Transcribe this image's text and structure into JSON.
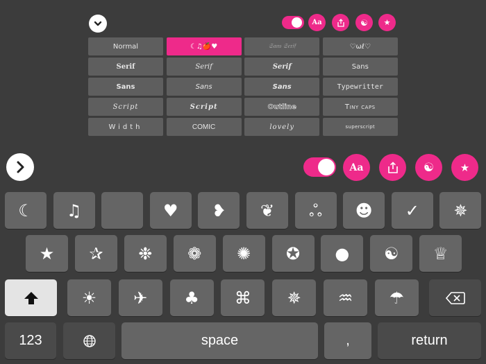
{
  "colors": {
    "accent": "#ee2a8a",
    "background": "#3c3c3c",
    "key": "#656565",
    "key_dark": "#4a4a4a",
    "shift_key": "#e4e4e4"
  },
  "mini_toolbar": {
    "collapse_icon": "chevron-down-icon",
    "toggle_on": true,
    "buttons": [
      {
        "name": "font-style-button",
        "icon": "font-aa-icon",
        "label": "Aa"
      },
      {
        "name": "share-button",
        "icon": "share-icon",
        "label": ""
      },
      {
        "name": "theme-button",
        "icon": "yin-yang-icon",
        "label": "☯"
      },
      {
        "name": "favorites-button",
        "icon": "star-icon",
        "label": "★"
      }
    ]
  },
  "styles": [
    {
      "label": "Normal",
      "cls": "",
      "active": false
    },
    {
      "label": "☾♫🍎♥",
      "cls": "",
      "active": true
    },
    {
      "label": "𝔖𝔞𝔫𝔰 𝔖𝔢𝔯𝔦𝔣",
      "cls": "s-gothic",
      "active": false
    },
    {
      "label": "♡ωℓ♡",
      "cls": "",
      "active": false
    },
    {
      "label": "Serif",
      "cls": "s-serif-b",
      "active": false
    },
    {
      "label": "Serif",
      "cls": "s-serif-i",
      "active": false
    },
    {
      "label": "Serif",
      "cls": "s-serif-bi",
      "active": false
    },
    {
      "label": "Sans",
      "cls": "",
      "active": false
    },
    {
      "label": "Sans",
      "cls": "s-sans-b",
      "active": false
    },
    {
      "label": "Sans",
      "cls": "s-sans-i",
      "active": false
    },
    {
      "label": "Sans",
      "cls": "s-sans-bi",
      "active": false
    },
    {
      "label": "Typewritter",
      "cls": "s-mono",
      "active": false
    },
    {
      "label": "Script",
      "cls": "s-script",
      "active": false
    },
    {
      "label": "Script",
      "cls": "s-script-b",
      "active": false
    },
    {
      "label": "Outline",
      "cls": "s-outline",
      "active": false
    },
    {
      "label": "Tiny caps",
      "cls": "s-tiny",
      "active": false
    },
    {
      "label": "Width",
      "cls": "s-width",
      "active": false
    },
    {
      "label": "COMIC",
      "cls": "s-comic",
      "active": false
    },
    {
      "label": "lovely",
      "cls": "s-lovely",
      "active": false
    },
    {
      "label": "superscript",
      "cls": "s-super",
      "active": false
    }
  ],
  "big_toolbar": {
    "expand_icon": "chevron-right-icon",
    "toggle_on": true,
    "buttons": [
      {
        "name": "font-style-button",
        "icon": "font-aa-icon",
        "label": "Aa"
      },
      {
        "name": "share-button",
        "icon": "share-icon",
        "label": ""
      },
      {
        "name": "theme-button",
        "icon": "yin-yang-icon",
        "label": "☯"
      },
      {
        "name": "favorites-button",
        "icon": "star-icon",
        "label": "★"
      }
    ]
  },
  "keyboard": {
    "row1": [
      {
        "name": "moon-icon",
        "glyph": "☾"
      },
      {
        "name": "music-note-icon",
        "glyph": "♫"
      },
      {
        "name": "apple-icon",
        "glyph": ""
      },
      {
        "name": "heart-icon",
        "glyph": "♥"
      },
      {
        "name": "heart-tilted-icon",
        "glyph": "❥"
      },
      {
        "name": "apple-heart-icon",
        "glyph": "❦"
      },
      {
        "name": "ribbon-icon",
        "glyph": "ஃ"
      },
      {
        "name": "smiley-icon",
        "glyph": "☻"
      },
      {
        "name": "checkmark-icon",
        "glyph": "✓"
      },
      {
        "name": "pinwheel-icon",
        "glyph": "✵"
      }
    ],
    "row2": [
      {
        "name": "star-icon",
        "glyph": "★"
      },
      {
        "name": "star-outline-icon",
        "glyph": "✰"
      },
      {
        "name": "snowflake-icon",
        "glyph": "❉"
      },
      {
        "name": "flower-icon",
        "glyph": "❁"
      },
      {
        "name": "sun-burst-icon",
        "glyph": "✺"
      },
      {
        "name": "star-circle-icon",
        "glyph": "✪"
      },
      {
        "name": "circle-icon",
        "glyph": "●"
      },
      {
        "name": "yin-yang-icon",
        "glyph": "☯"
      },
      {
        "name": "crown-icon",
        "glyph": "♕"
      }
    ],
    "row3": [
      {
        "name": "sun-icon",
        "glyph": "☀"
      },
      {
        "name": "airplane-icon",
        "glyph": "✈"
      },
      {
        "name": "clover-icon",
        "glyph": "♣"
      },
      {
        "name": "command-icon",
        "glyph": "⌘"
      },
      {
        "name": "sigil-icon",
        "glyph": "✵"
      },
      {
        "name": "steam-icon",
        "glyph": "♒"
      },
      {
        "name": "umbrella-icon",
        "glyph": "☂"
      }
    ],
    "shift_icon": "shift-arrow-icon",
    "backspace_icon": "backspace-icon",
    "numbers_label": "123",
    "globe_icon": "globe-icon",
    "space_label": "space",
    "comma_label": ",",
    "return_label": "return"
  }
}
